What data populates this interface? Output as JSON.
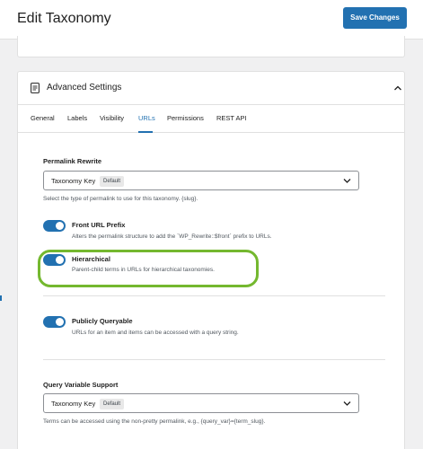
{
  "header": {
    "title": "Edit Taxonomy",
    "save_label": "Save Changes"
  },
  "panel": {
    "title": "Advanced Settings",
    "icons": {
      "panel": "document-icon",
      "collapse": "chevron-up-icon"
    }
  },
  "tabs": [
    {
      "label": "General",
      "active": false
    },
    {
      "label": "Labels",
      "active": false
    },
    {
      "label": "Visibility",
      "active": false
    },
    {
      "label": "URLs",
      "active": true
    },
    {
      "label": "Permissions",
      "active": false
    },
    {
      "label": "REST API",
      "active": false
    }
  ],
  "permalink": {
    "label": "Permalink Rewrite",
    "value": "Taxonomy Key",
    "badge": "Default",
    "help": "Select the type of permalink to use for this taxonomy. {slug}."
  },
  "toggles": [
    {
      "title": "Front URL Prefix",
      "description": "Alters the permalink structure to add the `WP_Rewrite::$front` prefix to URLs.",
      "on": true
    },
    {
      "title": "Hierarchical",
      "description": "Parent-child terms in URLs for hierarchical taxonomies.",
      "on": true
    },
    {
      "title": "Publicly Queryable",
      "description": "URLs for an item and items can be accessed with a query string.",
      "on": true
    }
  ],
  "query_var": {
    "label": "Query Variable Support",
    "value": "Taxonomy Key",
    "badge": "Default",
    "help": "Terms can be accessed using the non-pretty permalink, e.g., {query_var}={term_slug}."
  },
  "colors": {
    "accent": "#2271b1",
    "highlight": "#74b82f",
    "background": "#f0f0f1"
  }
}
